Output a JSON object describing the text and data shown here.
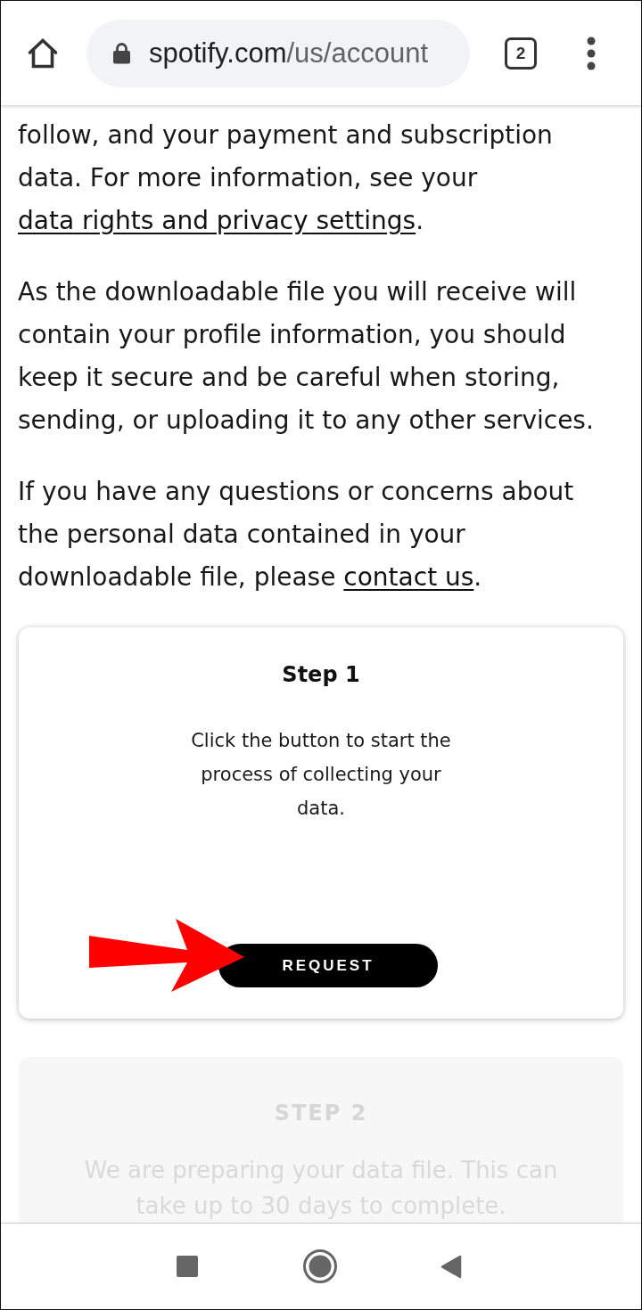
{
  "toolbar": {
    "address_bar": {
      "host": "spotify.com",
      "path": "/us/account"
    },
    "tab_count": "2"
  },
  "paragraphs": [
    {
      "parts": [
        {
          "kind": "text",
          "text": "follow, and your payment and subscription data. For more information, see your "
        },
        {
          "kind": "link",
          "text": "data rights and privacy settings"
        },
        {
          "kind": "text",
          "text": "."
        }
      ]
    },
    {
      "parts": [
        {
          "kind": "text",
          "text": "As the downloadable file you will receive will contain your profile information, you should keep it secure and be careful when storing, sending, or uploading it to any other services."
        }
      ]
    },
    {
      "parts": [
        {
          "kind": "text",
          "text": "If you have any questions or concerns about the personal data contained in your downloadable file, please "
        },
        {
          "kind": "link",
          "text": "contact us"
        },
        {
          "kind": "text",
          "text": "."
        }
      ]
    }
  ],
  "steps": [
    {
      "title": "Step 1",
      "description": "Click the button to start the process of collecting your data.",
      "button": "REQUEST",
      "disabled": false
    },
    {
      "title": "STEP 2",
      "description": "We are preparing your data file. This can take up to 30 days to complete.",
      "disabled": true
    }
  ]
}
